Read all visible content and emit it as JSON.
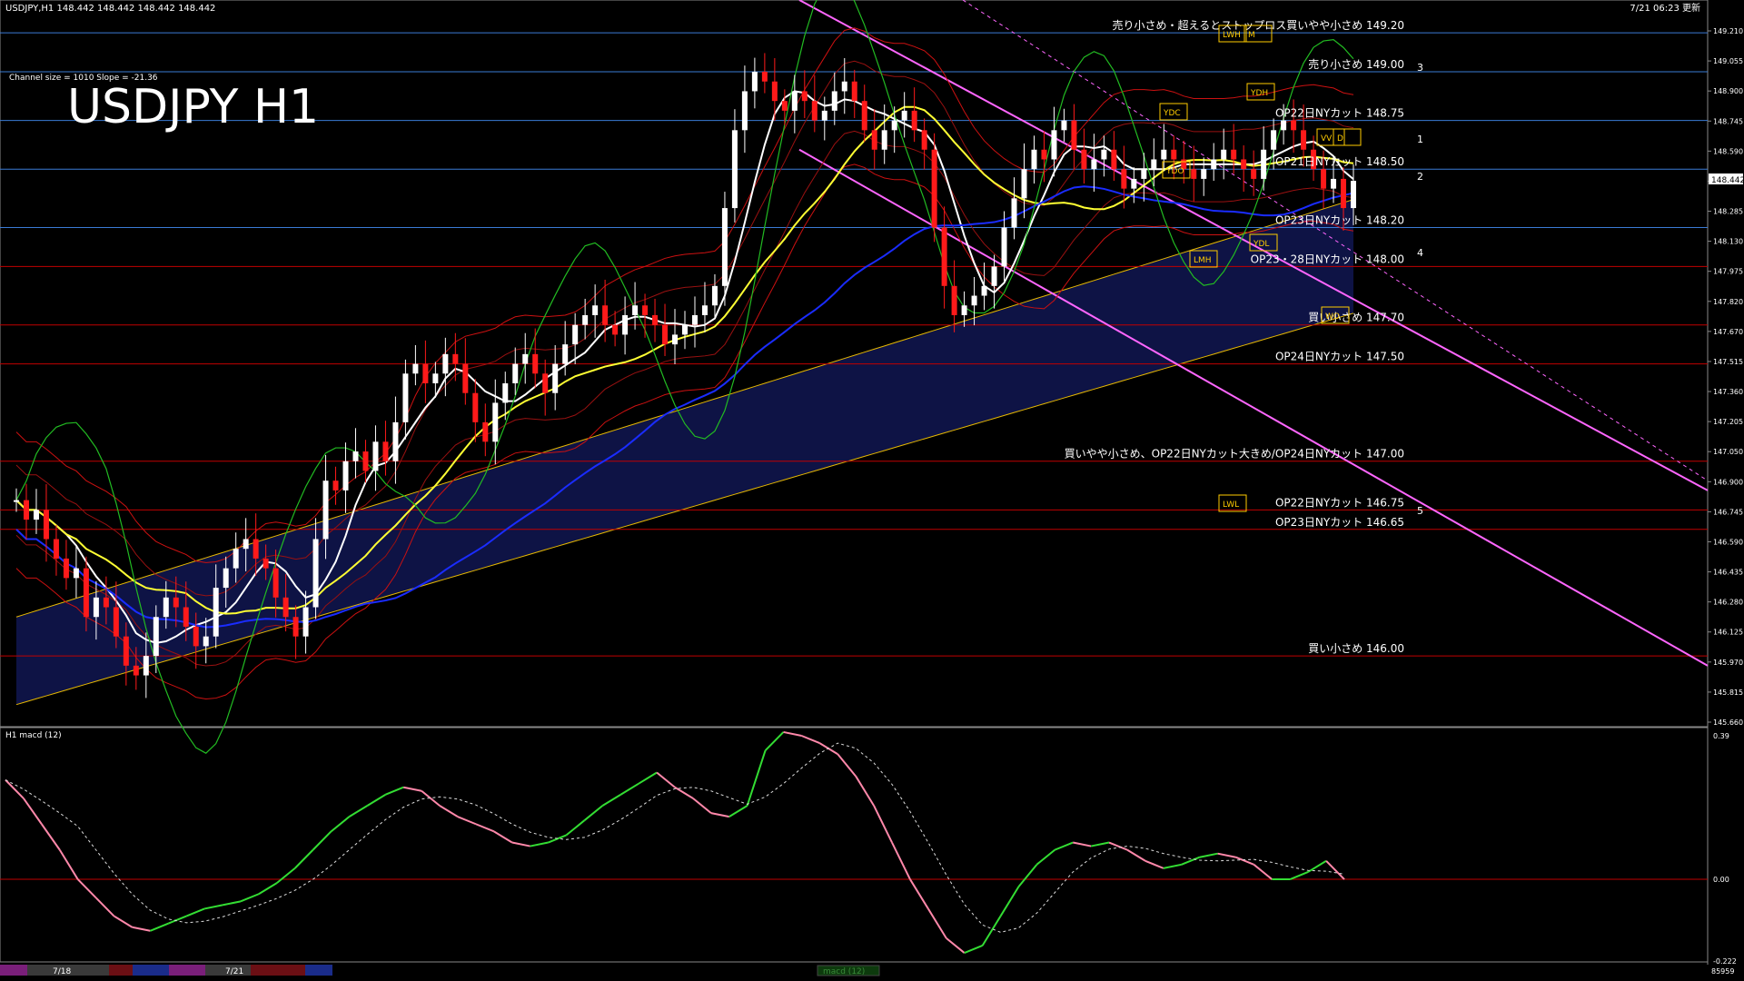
{
  "header": {
    "symbol_line": "USDJPY,H1  148.442 148.442 148.442 148.442",
    "datetime": "7/21 06:23 更新",
    "channel_info": "Channel size = 1010 Slope = -21.36",
    "big_title": "USDJPY H1"
  },
  "chart_data": [
    {
      "type": "candlestick",
      "title": "USDJPY H1",
      "ylim": [
        145.66,
        149.21
      ],
      "price_axis_ticks": [
        "149.210",
        "149.055",
        "148.900",
        "148.745",
        "148.590",
        "148.442",
        "148.285",
        "148.130",
        "147.975",
        "147.820",
        "147.670",
        "147.515",
        "147.360",
        "147.205",
        "147.050",
        "146.900",
        "146.745",
        "146.590",
        "146.435",
        "146.280",
        "146.125",
        "145.970",
        "145.815",
        "145.660"
      ],
      "current_price": "148.442",
      "horizontal_levels": [
        {
          "price": 149.2,
          "label": "売り小さめ・超えるとストップロス買いやや小さめ 149.20",
          "color": "#3a7bd5"
        },
        {
          "price": 149.0,
          "label": "売り小さめ 149.00",
          "color": "#3a7bd5"
        },
        {
          "price": 148.75,
          "label": "OP22日NYカット 148.75",
          "color": "#3a7bd5"
        },
        {
          "price": 148.5,
          "label": "OP21日NYカット 148.50",
          "color": "#3a7bd5"
        },
        {
          "price": 148.2,
          "label": "OP23日NYカット 148.20",
          "color": "#3a7bd5"
        },
        {
          "price": 148.0,
          "label": "OP23・28日NYカット 148.00",
          "color": "#c00000"
        },
        {
          "price": 147.7,
          "label": "買い小さめ 147.70",
          "color": "#c00000"
        },
        {
          "price": 147.5,
          "label": "OP24日NYカット 147.50",
          "color": "#c00000"
        },
        {
          "price": 147.0,
          "label": "買いやや小さめ、OP22日NYカット大きめ/OP24日NYカット 147.00",
          "color": "#c00000"
        },
        {
          "price": 146.75,
          "label": "OP22日NYカット 146.75",
          "color": "#c00000"
        },
        {
          "price": 146.65,
          "label": "OP23日NYカット 146.65",
          "color": "#c00000"
        },
        {
          "price": 146.0,
          "label": "買い小さめ 146.00",
          "color": "#c00000"
        }
      ],
      "boxed_labels": [
        "LWH",
        "M",
        "YDH",
        "YDC",
        "YDO",
        "VV",
        "D",
        "YDL",
        "LMH",
        "LWL",
        "WO"
      ],
      "channel_markers": [
        "3",
        "1",
        "2",
        "4",
        "5"
      ],
      "series": [
        {
          "name": "price",
          "values": [
            146.8,
            146.7,
            146.75,
            146.6,
            146.5,
            146.4,
            146.45,
            146.2,
            146.3,
            146.25,
            146.1,
            145.95,
            145.9,
            146.0,
            146.2,
            146.3,
            146.25,
            146.15,
            146.05,
            146.1,
            146.35,
            146.45,
            146.55,
            146.6,
            146.5,
            146.45,
            146.3,
            146.2,
            146.1,
            146.25,
            146.6,
            146.9,
            146.85,
            147.0,
            147.05,
            146.95,
            147.1,
            147.0,
            147.2,
            147.45,
            147.5,
            147.4,
            147.45,
            147.55,
            147.5,
            147.35,
            147.2,
            147.1,
            147.3,
            147.4,
            147.5,
            147.55,
            147.45,
            147.35,
            147.5,
            147.6,
            147.7,
            147.75,
            147.8,
            147.7,
            147.65,
            147.75,
            147.8,
            147.75,
            147.7,
            147.6,
            147.65,
            147.7,
            147.75,
            147.8,
            147.9,
            148.3,
            148.7,
            148.9,
            149.0,
            148.95,
            148.85,
            148.8,
            148.9,
            148.85,
            148.75,
            148.8,
            148.9,
            148.95,
            148.85,
            148.7,
            148.6,
            148.7,
            148.75,
            148.8,
            148.7,
            148.6,
            148.2,
            147.9,
            147.75,
            147.8,
            147.85,
            147.9,
            148.0,
            148.2,
            148.35,
            148.5,
            148.6,
            148.55,
            148.7,
            148.75,
            148.6,
            148.5,
            148.55,
            148.6,
            148.5,
            148.4,
            148.45,
            148.5,
            148.55,
            148.6,
            148.55,
            148.5,
            148.45,
            148.5,
            148.55,
            148.6,
            148.55,
            148.5,
            148.45,
            148.6,
            148.7,
            148.75,
            148.7,
            148.6,
            148.5,
            148.4,
            148.45,
            148.3,
            148.44
          ]
        }
      ]
    },
    {
      "type": "line",
      "title": "H1 macd (12)",
      "ylim": [
        -0.222,
        0.39
      ],
      "axis_ticks": [
        "0.39",
        "0.00",
        "-0.222"
      ],
      "series": [
        {
          "name": "macd",
          "values": [
            0.27,
            0.22,
            0.15,
            0.08,
            0.0,
            -0.05,
            -0.1,
            -0.13,
            -0.14,
            -0.12,
            -0.1,
            -0.08,
            -0.07,
            -0.06,
            -0.04,
            -0.01,
            0.03,
            0.08,
            0.13,
            0.17,
            0.2,
            0.23,
            0.25,
            0.24,
            0.2,
            0.17,
            0.15,
            0.13,
            0.1,
            0.09,
            0.1,
            0.12,
            0.16,
            0.2,
            0.23,
            0.26,
            0.29,
            0.25,
            0.22,
            0.18,
            0.17,
            0.2,
            0.35,
            0.4,
            0.39,
            0.37,
            0.34,
            0.28,
            0.2,
            0.1,
            0.0,
            -0.08,
            -0.16,
            -0.2,
            -0.18,
            -0.1,
            -0.02,
            0.04,
            0.08,
            0.1,
            0.09,
            0.1,
            0.08,
            0.05,
            0.03,
            0.04,
            0.06,
            0.07,
            0.06,
            0.04,
            0.0,
            0.0,
            0.02,
            0.05,
            0.0
          ]
        }
      ]
    }
  ],
  "bottom_bar": {
    "date1": "7/18",
    "date2": "7/21",
    "indicator_tab": "macd (12)",
    "corner": "85959"
  }
}
